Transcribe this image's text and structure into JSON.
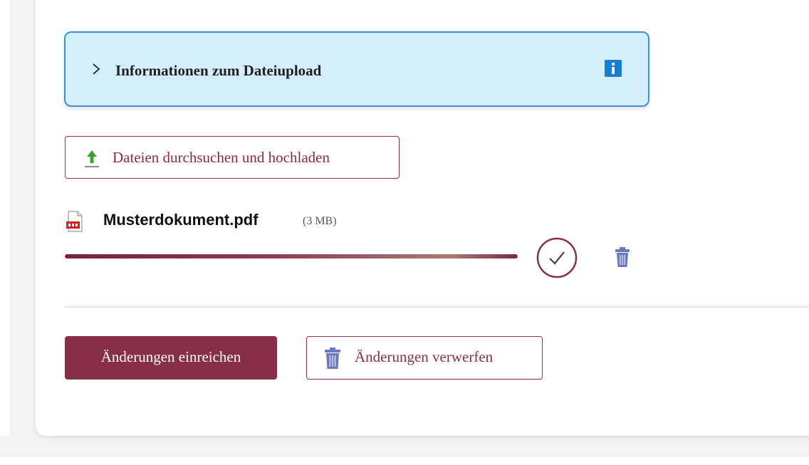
{
  "colors": {
    "brand": "#862f47",
    "info_background": "#d4eefb",
    "info_border": "#3d8fd6",
    "info_icon": "#1a7ed0",
    "trash_icon": "#6e78bd",
    "upload_arrow": "#3aa12d"
  },
  "info": {
    "title": "Informationen zum Dateiupload",
    "chevron_icon": "chevron-right-icon",
    "icon": "info-icon"
  },
  "upload": {
    "label": "Dateien durchsuchen und hochladen",
    "icon": "upload-icon"
  },
  "file": {
    "name": "Musterdokument.pdf",
    "size": "(3 MB)",
    "type_icon": "pdf-file-icon",
    "progress_percent": 100,
    "status_icon": "check-circle-icon",
    "delete_icon": "trash-icon"
  },
  "actions": {
    "submit_label": "Änderungen einreichen",
    "discard_label": "Änderungen verwerfen",
    "discard_icon": "trash-icon"
  }
}
